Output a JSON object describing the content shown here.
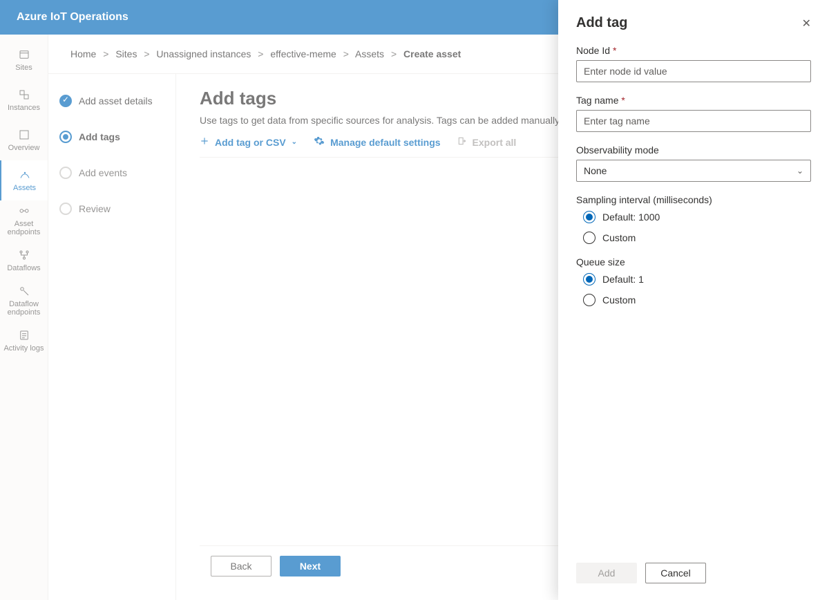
{
  "header": {
    "app_title": "Azure IoT Operations"
  },
  "rail": {
    "items": [
      {
        "id": "sites",
        "label": "Sites"
      },
      {
        "id": "instances",
        "label": "Instances"
      },
      {
        "id": "overview",
        "label": "Overview"
      },
      {
        "id": "assets",
        "label": "Assets"
      },
      {
        "id": "asset-endpoints",
        "label": "Asset endpoints"
      },
      {
        "id": "dataflows",
        "label": "Dataflows"
      },
      {
        "id": "dataflow-endpoints",
        "label": "Dataflow endpoints"
      },
      {
        "id": "activity-logs",
        "label": "Activity logs"
      }
    ],
    "active": "assets"
  },
  "breadcrumb": {
    "items": [
      {
        "label": "Home"
      },
      {
        "label": "Sites"
      },
      {
        "label": "Unassigned instances"
      },
      {
        "label": "effective-meme"
      },
      {
        "label": "Assets"
      }
    ],
    "current": "Create asset",
    "sep": ">"
  },
  "wizard": {
    "steps": [
      {
        "label": "Add asset details",
        "state": "completed"
      },
      {
        "label": "Add tags",
        "state": "active"
      },
      {
        "label": "Add events",
        "state": "pending"
      },
      {
        "label": "Review",
        "state": "pending"
      }
    ]
  },
  "page": {
    "title": "Add tags",
    "description": "Use tags to get data from specific sources for analysis. Tags can be added manually or by CSV. Learn more"
  },
  "actions": {
    "add_tag_label": "Add tag or CSV",
    "manage_settings_label": "Manage default settings",
    "export_label": "Export all"
  },
  "footer": {
    "back": "Back",
    "next": "Next"
  },
  "panel": {
    "title": "Add tag",
    "fields": {
      "node_id": {
        "label": "Node Id",
        "required": true,
        "placeholder": "Enter node id value",
        "value": ""
      },
      "tag_name": {
        "label": "Tag name",
        "required": true,
        "placeholder": "Enter tag name",
        "value": ""
      },
      "observability_mode": {
        "label": "Observability mode",
        "selected": "None"
      },
      "sampling_interval": {
        "label": "Sampling interval (milliseconds)",
        "options": {
          "default": "Default: 1000",
          "custom": "Custom"
        },
        "selected": "default"
      },
      "queue_size": {
        "label": "Queue size",
        "options": {
          "default": "Default: 1",
          "custom": "Custom"
        },
        "selected": "default"
      }
    },
    "footer": {
      "add": "Add",
      "cancel": "Cancel"
    }
  }
}
